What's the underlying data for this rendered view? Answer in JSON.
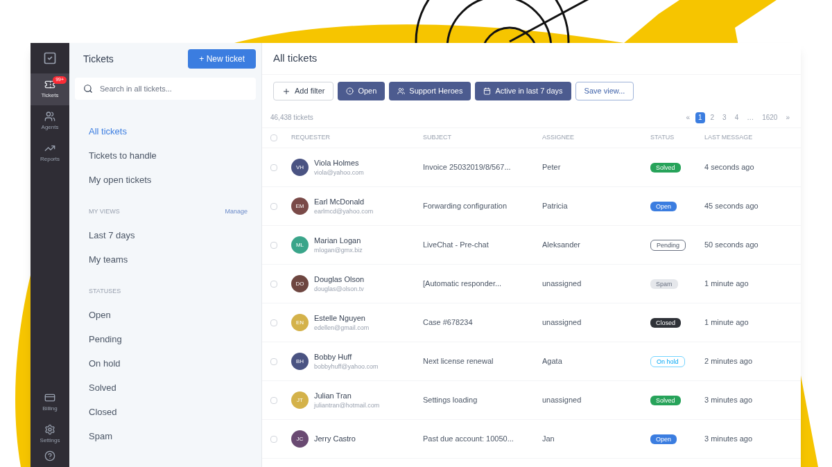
{
  "rail": {
    "items": [
      {
        "label": "Tickets",
        "kind": "tickets",
        "selected": true,
        "badge": "99+"
      },
      {
        "label": "Agents",
        "kind": "agents",
        "selected": false
      },
      {
        "label": "Reports",
        "kind": "reports",
        "selected": false
      }
    ],
    "bottom_items": [
      {
        "label": "Billing",
        "kind": "card",
        "selected": false
      },
      {
        "label": "Settings",
        "kind": "settings",
        "selected": false
      }
    ]
  },
  "panel": {
    "title": "Tickets",
    "new_button": "+ New ticket",
    "search": {
      "placeholder": "Search in all tickets..."
    },
    "views": [
      {
        "label": "All tickets",
        "selected": true
      },
      {
        "label": "Tickets to handle",
        "selected": false
      },
      {
        "label": "My open tickets",
        "selected": false
      }
    ],
    "my_views": {
      "heading": "MY VIEWS",
      "manage": "Manage",
      "items": [
        {
          "label": "Last 7 days",
          "selected": false
        },
        {
          "label": "My teams",
          "selected": false
        }
      ]
    },
    "statuses": {
      "heading": "STATUSES",
      "items": [
        {
          "label": "Open",
          "selected": false
        },
        {
          "label": "Pending",
          "selected": false
        },
        {
          "label": "On hold",
          "selected": false
        },
        {
          "label": "Solved",
          "selected": false
        },
        {
          "label": "Closed",
          "selected": false
        },
        {
          "label": "Spam",
          "selected": false
        }
      ]
    }
  },
  "main": {
    "title": "All tickets",
    "filters": [
      {
        "label": "Add filter",
        "kind": "add"
      },
      {
        "label": "Open",
        "kind": "status"
      },
      {
        "label": "Support Heroes",
        "kind": "team"
      },
      {
        "label": "Active in last 7 days",
        "kind": "date"
      },
      {
        "label": "Save view...",
        "kind": "save"
      }
    ],
    "count": "46,438 tickets",
    "pagination": {
      "prev": "«",
      "next": "»",
      "pages": [
        {
          "label": "1",
          "selected": true
        },
        {
          "label": "2",
          "selected": false
        },
        {
          "label": "3",
          "selected": false
        },
        {
          "label": "4",
          "selected": false
        },
        {
          "label": "…",
          "selected": false
        },
        {
          "label": "1620",
          "selected": false
        }
      ]
    },
    "table": {
      "select_all_checked": false,
      "columns": [
        "REQUESTER",
        "SUBJECT",
        "ASSIGNEE",
        "STATUS",
        "LAST MESSAGE"
      ],
      "rows": [
        {
          "checked": false,
          "initials": "VH",
          "color": "#4a5382",
          "name": "Viola Holmes",
          "email": "viola@yahoo.com",
          "subject": "Invoice 25032019/8/567...",
          "assignee": "Peter",
          "status": {
            "label": "Solved",
            "kind": "solved"
          },
          "last": "4 seconds ago"
        },
        {
          "checked": false,
          "initials": "EM",
          "color": "#7a4a48",
          "name": "Earl McDonald",
          "email": "earlmcd@yahoo.com",
          "subject": "Forwarding configuration",
          "assignee": "Patricia",
          "status": {
            "label": "Open",
            "kind": "open"
          },
          "last": "45 seconds ago"
        },
        {
          "checked": false,
          "initials": "ML",
          "color": "#3aa58a",
          "name": "Marian Logan",
          "email": "mlogan@gmx.biz",
          "subject": "LiveChat - Pre-chat",
          "assignee": "Aleksander",
          "status": {
            "label": "Pending",
            "kind": "pending"
          },
          "last": "50 seconds ago"
        },
        {
          "checked": false,
          "initials": "DO",
          "color": "#6e4640",
          "name": "Douglas Olson",
          "email": "douglas@olson.tv",
          "subject": "[Automatic responder...",
          "assignee": "unassigned",
          "status": {
            "label": "Spam",
            "kind": "spam"
          },
          "last": "1 minute ago"
        },
        {
          "checked": false,
          "initials": "EN",
          "color": "#d4b24a",
          "name": "Estelle Nguyen",
          "email": "edellen@gmail.com",
          "subject": "Case #678234",
          "assignee": "unassigned",
          "status": {
            "label": "Closed",
            "kind": "closed"
          },
          "last": "1 minute ago"
        },
        {
          "checked": false,
          "initials": "BH",
          "color": "#4a5382",
          "name": "Bobby Huff",
          "email": "bobbyhuff@yahoo.com",
          "subject": "Next license renewal",
          "assignee": "Agata",
          "status": {
            "label": "On hold",
            "kind": "hold"
          },
          "last": "2 minutes ago"
        },
        {
          "checked": false,
          "initials": "JT",
          "color": "#d4b24a",
          "name": "Julian Tran",
          "email": "juliantran@hotmail.com",
          "subject": "Settings loading",
          "assignee": "unassigned",
          "status": {
            "label": "Solved",
            "kind": "solved"
          },
          "last": "3 minutes ago"
        },
        {
          "checked": false,
          "initials": "JC",
          "color": "#6a4a72",
          "name": "Jerry Castro",
          "subject": "Past due account: 10050...",
          "assignee": "Jan",
          "status": {
            "label": "Open",
            "kind": "open"
          },
          "last": "3 minutes ago"
        }
      ]
    }
  }
}
